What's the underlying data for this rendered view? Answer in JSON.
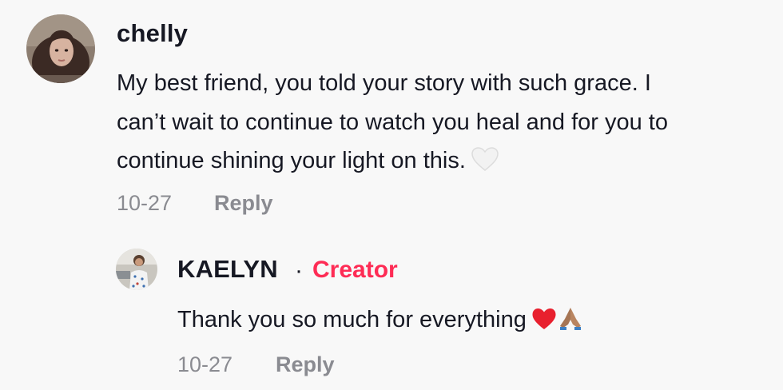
{
  "comment": {
    "username": "chelly",
    "lines": [
      "My best friend, you told your story with such grace. I",
      "can’t wait to continue to watch you heal and for you to",
      "continue shining your light on this."
    ],
    "emoji": "white-heart-icon",
    "date": "10-27",
    "reply_label": "Reply"
  },
  "reply": {
    "username": "KAELYN",
    "separator": "·",
    "badge": "Creator",
    "text": "Thank you so much for everything",
    "emojis": [
      "red-heart-icon",
      "folded-hands-icon"
    ],
    "date": "10-27",
    "reply_label": "Reply"
  },
  "colors": {
    "background": "#f8f8f8",
    "text": "#161823",
    "muted": "#8a8b91",
    "creator": "#fe2c55"
  }
}
